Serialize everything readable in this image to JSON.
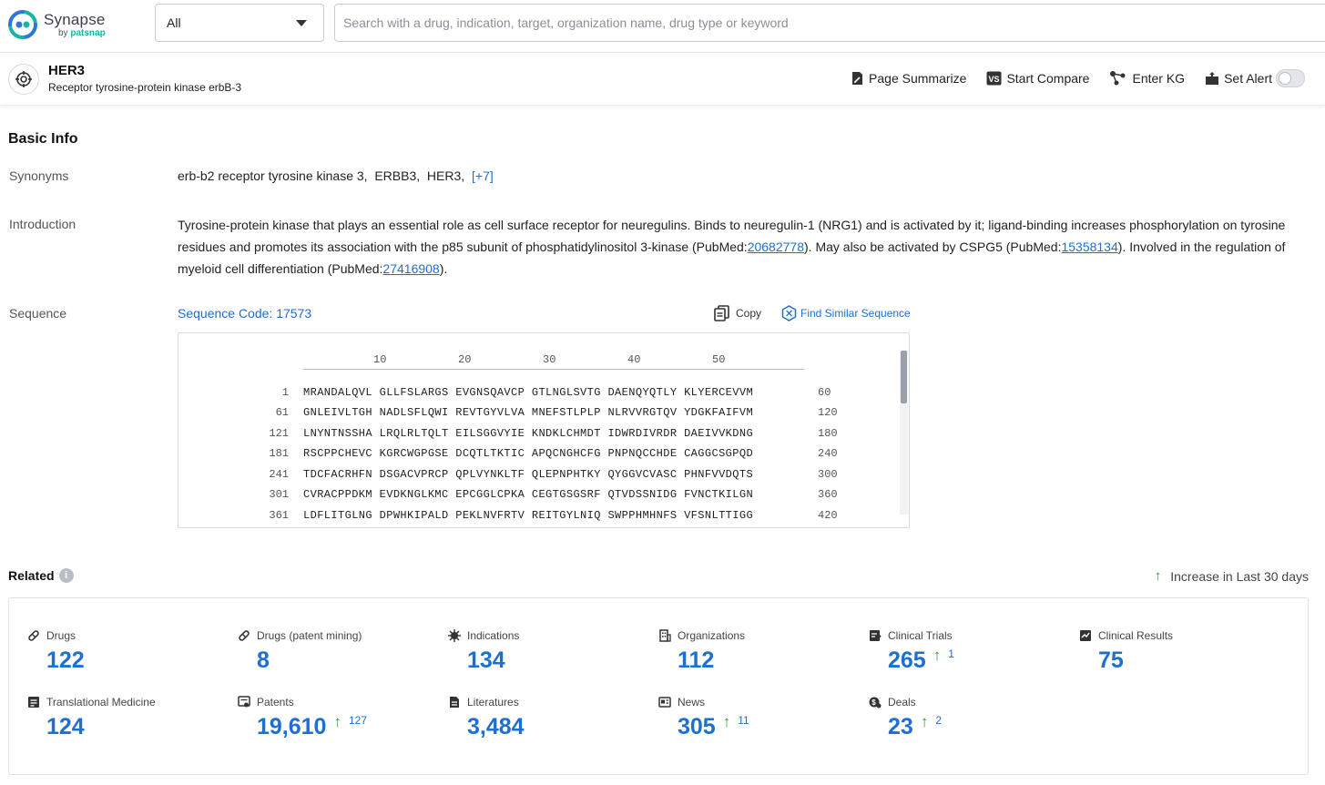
{
  "brand": {
    "name": "Synapse",
    "by": "by",
    "maker": "patsnap",
    "colors": {
      "teal": "#1bb3a6",
      "blue": "#2b78d6"
    }
  },
  "search": {
    "scope_value": "All",
    "placeholder": "Search with a drug, indication, target, organization name, drug type or keyword"
  },
  "entity": {
    "title": "HER3",
    "subtitle": "Receptor tyrosine-protein kinase erbB-3",
    "icon": "target-icon"
  },
  "actions": [
    {
      "label": "Page Summarize",
      "icon": "summarize-icon"
    },
    {
      "label": "Start Compare",
      "icon": "compare-icon"
    },
    {
      "label": "Enter KG",
      "icon": "graph-icon"
    },
    {
      "label": "Set Alert",
      "icon": "alert-icon",
      "toggle_on": false
    }
  ],
  "basic_info": {
    "title": "Basic Info",
    "synonyms_label": "Synonyms",
    "synonyms": "erb-b2 receptor tyrosine kinase 3,  ERBB3,  HER3,",
    "synonyms_more": "[+7]",
    "introduction_label": "Introduction",
    "intro_1": "Tyrosine-protein kinase that plays an essential role as cell surface receptor for neuregulins. Binds to neuregulin-1 (NRG1) and is activated by it; ligand-binding increases phosphorylation on tyrosine residues and promotes its association with the p85 subunit of phosphatidylinositol 3-kinase (PubMed:",
    "intro_link_1": "20682778",
    "intro_2": "). May also be activated by CSPG5 (PubMed:",
    "intro_link_2": "15358134",
    "intro_3": "). Involved in the regulation of myeloid cell differentiation (PubMed:",
    "intro_link_3": "27416908",
    "intro_4": ").",
    "sequence_label": "Sequence",
    "sequence_code": "Sequence Code: 17573",
    "copy_label": "Copy",
    "find_similar_label": "Find Similar Sequence",
    "ruler": [
      "10",
      "20",
      "30",
      "40",
      "50"
    ],
    "sequence_lines": [
      {
        "start": "1",
        "residues": "MRANDALQVL GLLFSLARGS EVGNSQAVCP GTLNGLSVTG DAENQYQTLY KLYERCEVVM",
        "end": "60"
      },
      {
        "start": "61",
        "residues": "GNLEIVLTGH NADLSFLQWI REVTGYVLVA MNEFSTLPLP NLRVVRGTQV YDGKFAIFVM",
        "end": "120"
      },
      {
        "start": "121",
        "residues": "LNYNTNSSHA LRQLRLTQLT EILSGGVYIE KNDKLCHMDT IDWRDIVRDR DAEIVVKDNG",
        "end": "180"
      },
      {
        "start": "181",
        "residues": "RSCPPCHEVC KGRCWGPGSE DCQTLTKTIC APQCNGHCFG PNPNQCCHDE CAGGCSGPQD",
        "end": "240"
      },
      {
        "start": "241",
        "residues": "TDCFACRHFN DSGACVPRCP QPLVYNKLTF QLEPNPHTKY QYGGVCVASC PHNFVVDQTS",
        "end": "300"
      },
      {
        "start": "301",
        "residues": "CVRACPPDKM EVDKNGLKMC EPCGGLCPKA CEGTGSGSRF QTVDSSNIDG FVNCTKILGN",
        "end": "360"
      },
      {
        "start": "361",
        "residues": "LDFLITGLNG DPWHKIPALD PEKLNVFRTV REITGYLNIQ SWPPHMHNFS VFSNLTTIGG",
        "end": "420"
      }
    ]
  },
  "related": {
    "title": "Related",
    "info_glyph": "i",
    "increase_arrow": "↑",
    "increase_note": "Increase in Last 30 days",
    "stats": [
      {
        "label": "Drugs",
        "value": "122",
        "icon": "pill-icon",
        "increase": ""
      },
      {
        "label": "Drugs (patent mining)",
        "value": "8",
        "icon": "pill-icon",
        "increase": ""
      },
      {
        "label": "Indications",
        "value": "134",
        "icon": "virus-icon",
        "increase": ""
      },
      {
        "label": "Organizations",
        "value": "112",
        "icon": "building-icon",
        "increase": ""
      },
      {
        "label": "Clinical Trials",
        "value": "265",
        "icon": "clipboard-icon",
        "increase": "1"
      },
      {
        "label": "Clinical Results",
        "value": "75",
        "icon": "results-icon",
        "increase": ""
      },
      {
        "label": "Translational Medicine",
        "value": "124",
        "icon": "report-icon",
        "increase": ""
      },
      {
        "label": "Patents",
        "value": "19,610",
        "icon": "patent-icon",
        "increase": "127"
      },
      {
        "label": "Literatures",
        "value": "3,484",
        "icon": "document-icon",
        "increase": ""
      },
      {
        "label": "News",
        "value": "305",
        "icon": "news-icon",
        "increase": "11"
      },
      {
        "label": "Deals",
        "value": "23",
        "icon": "deals-icon",
        "increase": "2"
      }
    ]
  }
}
